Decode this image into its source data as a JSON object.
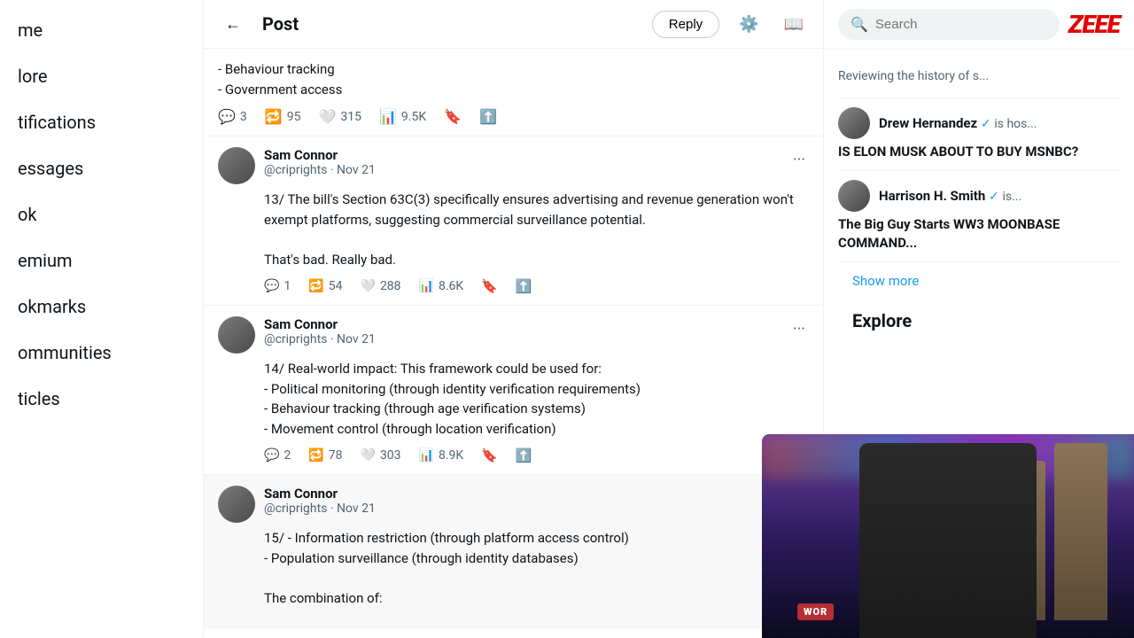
{
  "sidebar": {
    "items": [
      {
        "label": "me",
        "id": "home"
      },
      {
        "label": "lore",
        "id": "explore"
      },
      {
        "label": "tifications",
        "id": "notifications"
      },
      {
        "label": "essages",
        "id": "messages"
      },
      {
        "label": "ok",
        "id": "bookmarks-alt"
      },
      {
        "label": "emium",
        "id": "premium"
      },
      {
        "label": "okmarks",
        "id": "bookmarks"
      },
      {
        "label": "ommunities",
        "id": "communities"
      },
      {
        "label": "ticles",
        "id": "articles"
      }
    ]
  },
  "header": {
    "title": "Post",
    "back_label": "←",
    "reply_label": "Reply",
    "filter_icon": "⚙",
    "bookmark_icon": "📖"
  },
  "partial_tweet": {
    "lines": [
      "- Behaviour tracking",
      "- Government access"
    ],
    "replies": "3",
    "retweets": "95",
    "likes": "315",
    "views": "9.5K"
  },
  "tweets": [
    {
      "author": "Sam Connor",
      "handle": "@criprights",
      "date": "Nov 21",
      "body_parts": [
        "13/ The bill's Section 63C(3) specifically ensures advertising and revenue generation won't exempt platforms, suggesting commercial surveillance potential.",
        "",
        "That's bad. Really bad."
      ],
      "replies": "1",
      "retweets": "54",
      "likes": "288",
      "views": "8.6K",
      "highlighted": false
    },
    {
      "author": "Sam Connor",
      "handle": "@criprights",
      "date": "Nov 21",
      "body_parts": [
        "14/ Real-world impact: This framework could be used for:",
        "- Political monitoring (through identity verification requirements)",
        "- Behaviour tracking (through age verification systems)",
        "- Movement control (through location verification)"
      ],
      "replies": "2",
      "retweets": "78",
      "likes": "303",
      "views": "8.9K",
      "highlighted": false
    },
    {
      "author": "Sam Connor",
      "handle": "@criprights",
      "date": "Nov 21",
      "body_parts": [
        "15/ - Information restriction (through platform access control)",
        "- Population surveillance (through identity databases)",
        "",
        "The combination of:"
      ],
      "replies": "",
      "retweets": "",
      "likes": "",
      "views": "",
      "highlighted": true
    }
  ],
  "right_sidebar": {
    "search_placeholder": "Search",
    "zeee_logo": "ZEEE",
    "reviewing_text": "Reviewing the history of s...",
    "trending": [
      {
        "user": "Drew Hernandez",
        "verified": true,
        "host_text": "is hos...",
        "headline": "IS ELON MUSK ABOUT TO BUY MSNBC?"
      },
      {
        "user": "Harrison H. Smith",
        "verified": true,
        "verified2": true,
        "host_text": "is...",
        "headline": "The Big Guy Starts WW3 MOONBASE COMMAND..."
      }
    ],
    "show_more_label": "Show more",
    "explore_title": "Explore"
  }
}
